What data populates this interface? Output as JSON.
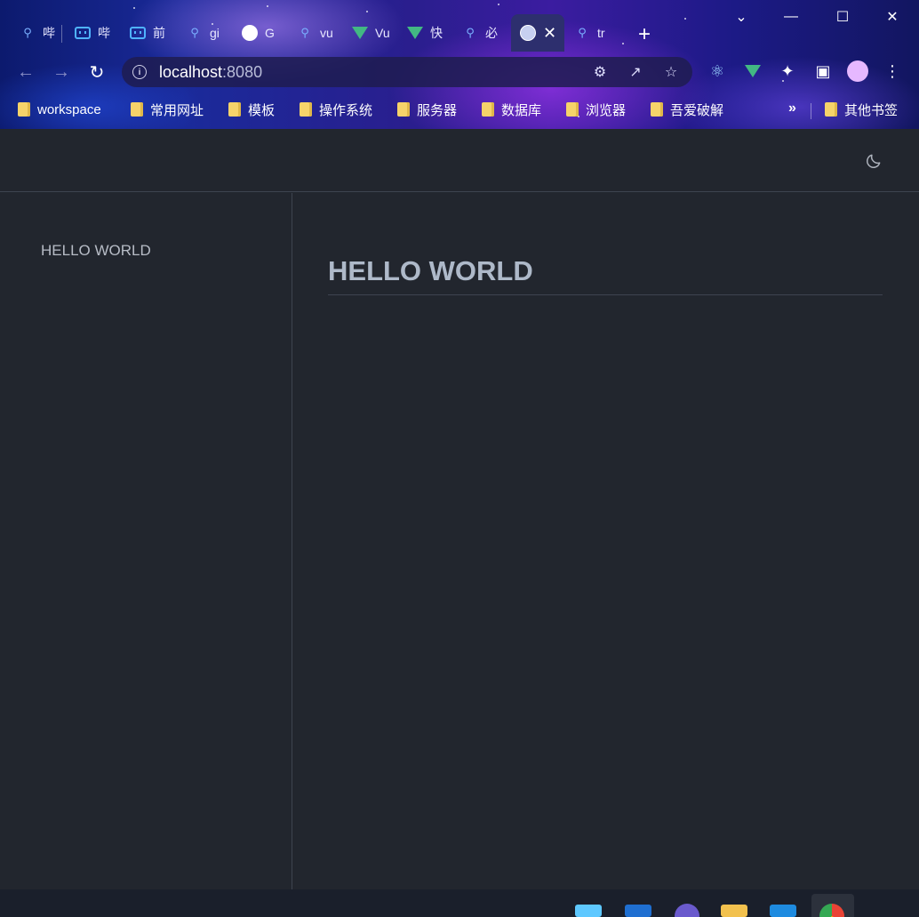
{
  "browser": {
    "tabs": [
      {
        "label": "哔",
        "icon": "search-icon"
      },
      {
        "label": "哔",
        "icon": "bilibili-icon"
      },
      {
        "label": "前",
        "icon": "bilibili-icon"
      },
      {
        "label": "gi",
        "icon": "search-icon"
      },
      {
        "label": "G",
        "icon": "github-icon"
      },
      {
        "label": "vu",
        "icon": "search-icon"
      },
      {
        "label": "Vu",
        "icon": "vue-icon"
      },
      {
        "label": "快",
        "icon": "vue-icon"
      },
      {
        "label": "必",
        "icon": "search-icon"
      },
      {
        "label": "",
        "icon": "globe-icon",
        "active": true
      },
      {
        "label": "tr",
        "icon": "search-icon"
      }
    ],
    "url_host": "localhost",
    "url_port": ":8080",
    "bookmarks": [
      "workspace",
      "常用网址",
      "模板",
      "操作系统",
      "服务器",
      "数据库",
      "浏览器",
      "吾爱破解"
    ],
    "other_bookmarks": "其他书签",
    "more_symbol": "»"
  },
  "page": {
    "sidebar": {
      "link": "HELLO WORLD"
    },
    "content": {
      "title": "HELLO WORLD"
    }
  },
  "colors": {
    "page_bg": "#22262e",
    "border": "#3e4450",
    "title": "#aeb9c9",
    "sidebar_text": "#b7bcc6"
  }
}
